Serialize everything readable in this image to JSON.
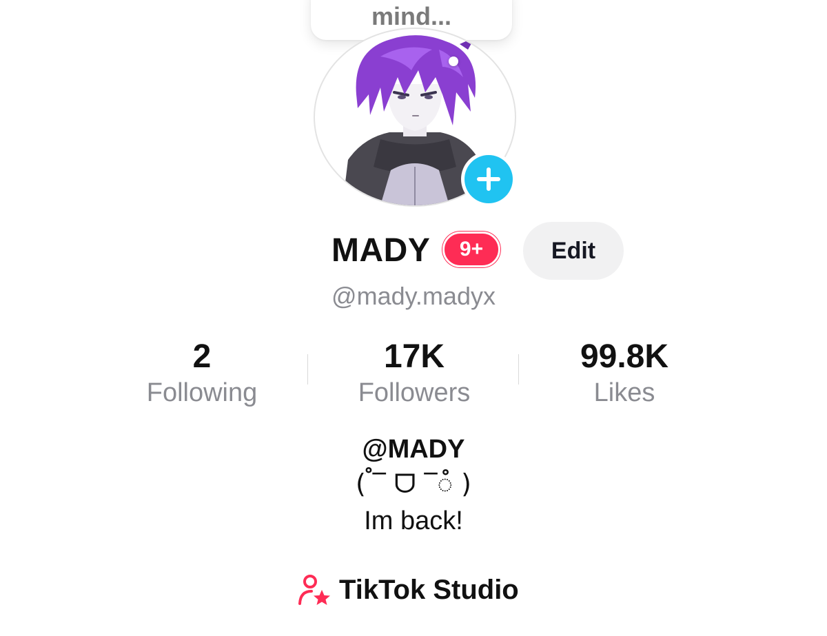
{
  "thought_bubble": {
    "text": "mind..."
  },
  "profile": {
    "display_name": "MADY",
    "notification_badge": "9+",
    "edit_label": "Edit",
    "username": "@mady.madyx"
  },
  "stats": [
    {
      "value": "2",
      "label": "Following"
    },
    {
      "value": "17K",
      "label": "Followers"
    },
    {
      "value": "99.8K",
      "label": "Likes"
    }
  ],
  "bio": {
    "title": "@MADY",
    "line1": "( ꠋ‾ ᗜ ‾ꠋ )",
    "line2": "Im back!"
  },
  "studio": {
    "label": "TikTok Studio",
    "icon": "person-star-icon"
  },
  "colors": {
    "accent_red": "#fe2c55",
    "add_button_blue": "#20c3f1",
    "secondary_text": "#8a8b91",
    "edit_button_bg": "#f1f1f2"
  }
}
